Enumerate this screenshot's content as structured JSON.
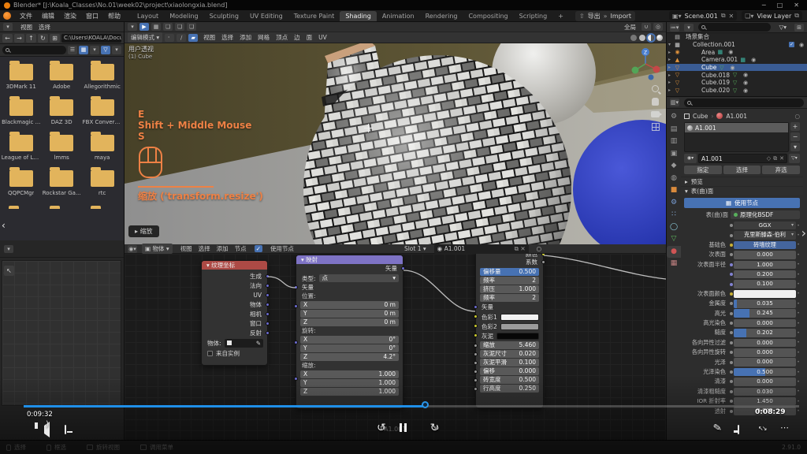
{
  "titlebar": {
    "title": "Blender* [J:\\Koala_Classes\\No.01\\week02\\project\\xiaolongxia.blend]",
    "minimize": "─",
    "maximize": "□",
    "close": "✕"
  },
  "topbar": {
    "menus": [
      "文件",
      "编辑",
      "渲染",
      "窗口",
      "帮助"
    ],
    "workspaces": [
      {
        "label": "Layout"
      },
      {
        "label": "Modeling"
      },
      {
        "label": "Sculpting"
      },
      {
        "label": "UV Editing"
      },
      {
        "label": "Texture Paint"
      },
      {
        "label": "Shading",
        "state": "active"
      },
      {
        "label": "Animation"
      },
      {
        "label": "Rendering"
      },
      {
        "label": "Compositing"
      },
      {
        "label": "Scripting"
      },
      {
        "label": "+"
      }
    ],
    "export_label": "导出",
    "import_label": "Import",
    "scene": "Scene.001",
    "view_layer": "View Layer"
  },
  "file_browser": {
    "menus": [
      "视图",
      "选择"
    ],
    "path": "C:\\Users\\KOALA\\Docu..",
    "folders": [
      "3DMark 11",
      "Adobe",
      "Allegorithmic",
      "Blackmagic ...",
      "DAZ 3D",
      "FBX Converte...",
      "League of Leg...",
      "lmms",
      "maya",
      "QQPCMgr",
      "Rockstar Ga...",
      "rtc"
    ]
  },
  "viewport": {
    "orientation": "全局",
    "mode": "编辑模式",
    "menus": [
      "视图",
      "选择",
      "添加",
      "网格",
      "顶点",
      "边",
      "面",
      "UV"
    ],
    "view_label": "用户透视",
    "object_label": "(1) Cube",
    "hotkey_1": "E",
    "hotkey_2": "Shift + Middle Mouse",
    "hotkey_3": "S",
    "operator_hint": "缩放 ('transform.resize')",
    "operator_panel": "缩放"
  },
  "node_editor": {
    "pane_object": "物体",
    "menus": [
      "视图",
      "选择",
      "添加",
      "节点"
    ],
    "use_nodes": "使用节点",
    "slot": "Slot 1",
    "material": "A1.001",
    "tree_label": "A1.001",
    "texcoord": {
      "title": "纹理坐标",
      "outputs": [
        "生成",
        "法向",
        "UV",
        "物体",
        "相机",
        "窗口",
        "反射"
      ],
      "object_label": "物体:",
      "from_instancer": "来自实例"
    },
    "mapping": {
      "title": "映射",
      "output": "矢量",
      "type_label": "类型:",
      "type_value": "点",
      "vector_label": "矢量",
      "loc_label": "位置:",
      "rot_label": "旋转:",
      "scale_label": "缩放:",
      "loc": [
        {
          "k": "X",
          "v": "0 m"
        },
        {
          "k": "Y",
          "v": "0 m"
        },
        {
          "k": "Z",
          "v": "0 m"
        }
      ],
      "rot": [
        {
          "k": "X",
          "v": "0°"
        },
        {
          "k": "Y",
          "v": "0°"
        },
        {
          "k": "Z",
          "v": "4.2°"
        }
      ],
      "scl": [
        {
          "k": "X",
          "v": "1.000"
        },
        {
          "k": "Y",
          "v": "1.000"
        },
        {
          "k": "Z",
          "v": "1.000"
        }
      ]
    },
    "brick": {
      "out_color": "颜色",
      "out_fac": "系数",
      "params": [
        {
          "k": "偏移量",
          "v": "0.500",
          "state": "hl"
        },
        {
          "k": "频率",
          "v": "2"
        },
        {
          "k": "挤压",
          "v": "1.000"
        },
        {
          "k": "频率",
          "v": "2"
        }
      ],
      "vector_label": "矢量",
      "colors": [
        {
          "k": "色彩1",
          "swatch": "#f2f2f2"
        },
        {
          "k": "色彩2",
          "swatch": "#9b9b9b"
        },
        {
          "k": "灰泥",
          "swatch": "#070707"
        }
      ],
      "values": [
        {
          "k": "缩放",
          "v": "5.460"
        },
        {
          "k": "灰泥尺寸",
          "v": "0.020"
        },
        {
          "k": "灰泥平滑",
          "v": "0.100"
        },
        {
          "k": "偏移",
          "v": "0.000"
        },
        {
          "k": "砖宽度",
          "v": "0.500"
        },
        {
          "k": "行高度",
          "v": "0.250"
        }
      ]
    }
  },
  "outliner": {
    "rows": [
      {
        "label": "场景集合",
        "icon": "▤",
        "kind": "scn",
        "ind": "i0",
        "dis": "",
        "eye": "",
        "check": ""
      },
      {
        "label": "Collection.001",
        "icon": "▦",
        "kind": "col",
        "ind": "i1",
        "dis": "▾",
        "eye": "◉",
        "check": "✓"
      },
      {
        "label": "Area",
        "icon": "◉",
        "kind": "lgt",
        "ind": "i2",
        "dis": "▸",
        "eye": "◉",
        "sub": "▦",
        "kind2": "teal",
        "check": ""
      },
      {
        "label": "Camera.001",
        "icon": "▲",
        "kind": "cam",
        "ind": "i2",
        "dis": "▸",
        "eye": "◉",
        "sub": "▦",
        "kind2": "teal",
        "check": ""
      },
      {
        "label": "Cube",
        "icon": "▽",
        "kind": "msh",
        "ind": "i2",
        "dis": "▸",
        "eye": "◉",
        "sub": "▽",
        "kind2": "grn",
        "state": "sel",
        "check": ""
      },
      {
        "label": "Cube.018",
        "icon": "▽",
        "kind": "msh",
        "ind": "i2",
        "dis": "▸",
        "eye": "◉",
        "sub": "▽",
        "kind2": "grn",
        "check": ""
      },
      {
        "label": "Cube.019",
        "icon": "▽",
        "kind": "msh",
        "ind": "i2",
        "dis": "▸",
        "eye": "◉",
        "sub": "▽",
        "kind2": "grn",
        "check": ""
      },
      {
        "label": "Cube.020",
        "icon": "▽",
        "kind": "msh",
        "ind": "i2",
        "dis": "▸",
        "eye": "◉",
        "sub": "▽",
        "kind2": "grn",
        "check": ""
      }
    ]
  },
  "properties": {
    "tabs": [
      {
        "g": "⚙",
        "name": "tool"
      },
      {
        "g": "▤",
        "name": "render"
      },
      {
        "g": "▥",
        "name": "output"
      },
      {
        "g": "▣",
        "name": "view-layer"
      },
      {
        "g": "◆",
        "name": "scene"
      },
      {
        "g": "◍",
        "name": "world"
      },
      {
        "g": "■",
        "name": "object",
        "c": "#d98a3c"
      },
      {
        "g": "⚙",
        "name": "modifiers",
        "c": "#7aa0d8"
      },
      {
        "g": "∷",
        "name": "particles",
        "c": "#8fb4e0"
      },
      {
        "g": "◯",
        "name": "physics",
        "c": "#8fd0e0"
      },
      {
        "g": "▽",
        "name": "data",
        "c": "#5fb85f"
      },
      {
        "g": "●",
        "name": "material",
        "c": "#d05555",
        "state": "active"
      },
      {
        "g": "▦",
        "name": "texture",
        "c": "#c08080"
      }
    ],
    "crumb_object": "Cube",
    "crumb_material": "A1.001",
    "slot_name": "A1.001",
    "datablock_name": "A1.001",
    "actions": [
      "指定",
      "选择",
      "弃选"
    ],
    "preview_label": "预览",
    "surface_section": "表(曲)面",
    "use_nodes": "使用节点",
    "surface_label": "表(曲)面",
    "surface_value": "原理化BSDF",
    "fields": [
      {
        "label": "",
        "value": "GGX",
        "style": "select"
      },
      {
        "label": "",
        "value": "克里斯滕森-伯利",
        "style": "select"
      },
      {
        "label": "基础色",
        "value": "砖墙纹理",
        "style": "linked",
        "dot": "y"
      },
      {
        "label": "次表面",
        "value": "0.000"
      },
      {
        "label": "次表面半径",
        "value": "1.000",
        "dot": "v"
      },
      {
        "label": "",
        "value": "0.200",
        "dot": "v"
      },
      {
        "label": "",
        "value": "0.100",
        "dot": "v"
      },
      {
        "label": "次表面颜色",
        "swatch": "#f0f0f0",
        "dot": "y"
      },
      {
        "label": "金属度",
        "value": "0.035",
        "fill": 0.05
      },
      {
        "label": "高光",
        "value": "0.245",
        "fill": 0.25
      },
      {
        "label": "高光染色",
        "value": "0.000"
      },
      {
        "label": "糙度",
        "value": "0.202",
        "fill": 0.2
      },
      {
        "label": "各向异性过滤",
        "value": "0.000"
      },
      {
        "label": "各向异性旋转",
        "value": "0.000"
      },
      {
        "label": "光泽",
        "value": "0.000"
      },
      {
        "label": "光泽染色",
        "value": "0.500",
        "fill": 0.5
      },
      {
        "label": "清漆",
        "value": "0.000"
      },
      {
        "label": "清漆粗糙度",
        "value": "0.030"
      },
      {
        "label": "IOR 折射率",
        "value": "1.450"
      },
      {
        "label": "透射",
        "value": "0.000"
      }
    ]
  },
  "player": {
    "elapsed": "0:09:32",
    "remaining": "0:08:29",
    "progress": 0.52,
    "skip_back": "10",
    "skip_forward": "30"
  },
  "statusbar": {
    "items": [
      {
        "icon": "mouse",
        "label": "选择"
      },
      {
        "icon": "mouse",
        "label": "框选"
      },
      {
        "icon": "key",
        "label": "旋转视图"
      },
      {
        "icon": "key",
        "label": "调用菜单"
      }
    ],
    "version": "2.91.0"
  },
  "colors": {
    "accent_blue": "#4772b3",
    "progress_blue": "#1f8fe8",
    "overlay_orange": "#ee8145",
    "folder_yellow": "#e2b45c",
    "selection_blue": "#3a5c94",
    "node_header_red": "#ad4a45",
    "node_header_purple": "#7e73c5"
  }
}
